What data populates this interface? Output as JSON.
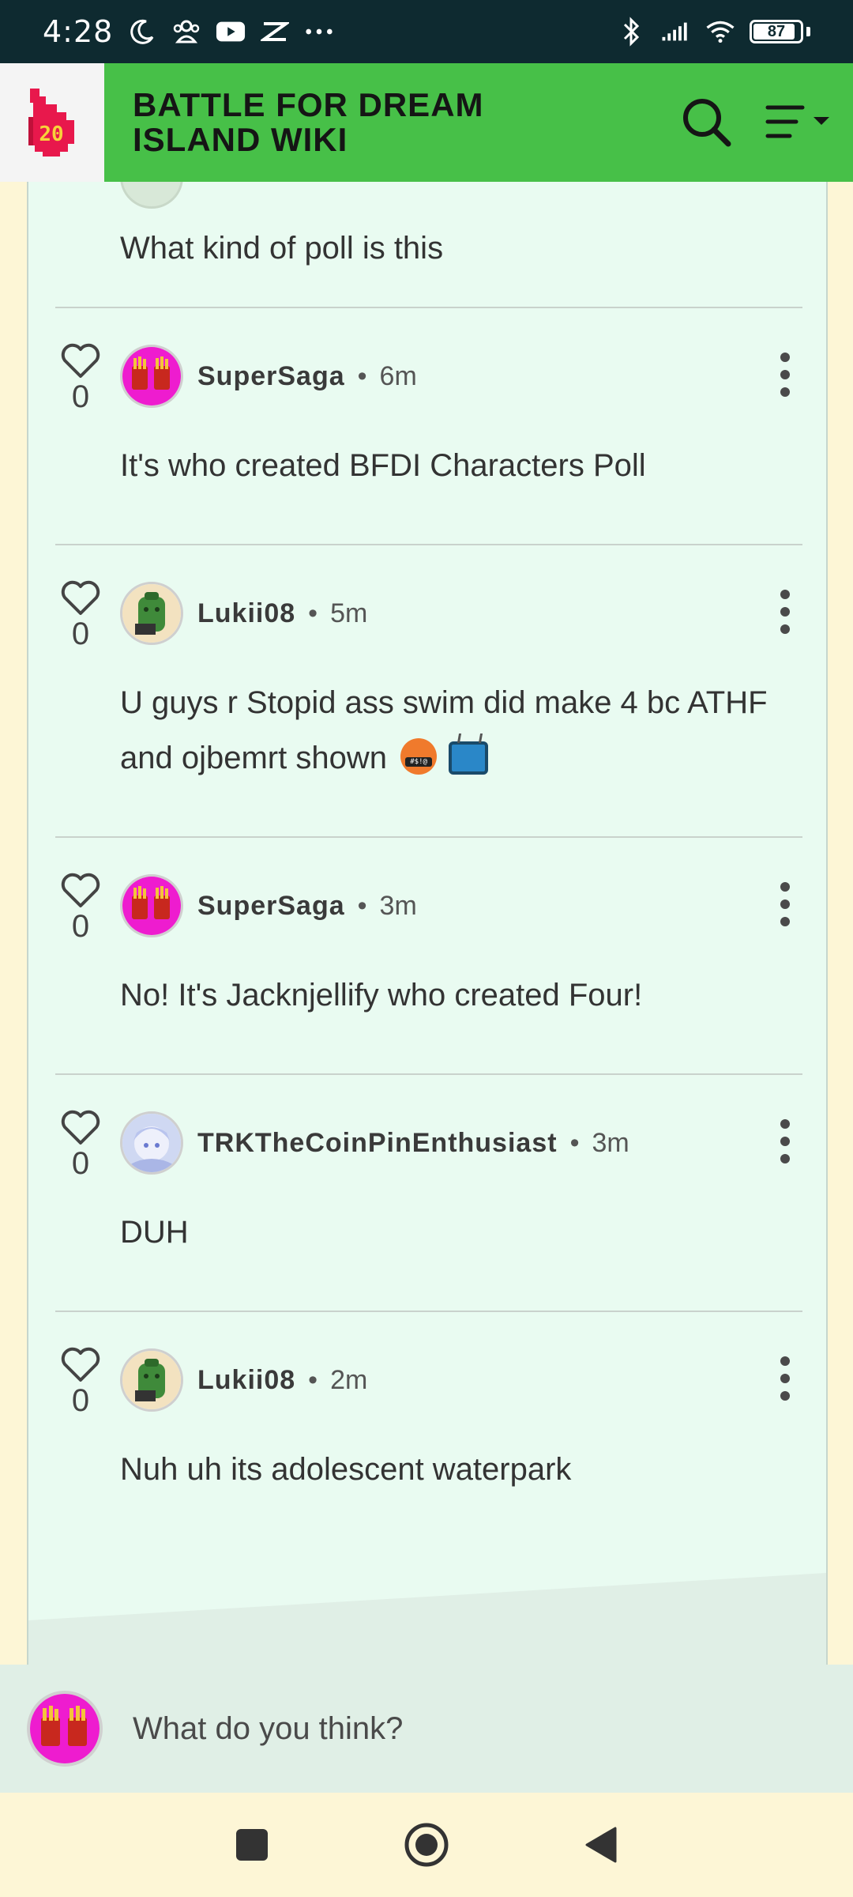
{
  "status_bar": {
    "time": "4:28",
    "battery": "87"
  },
  "header": {
    "logo_text": "20",
    "title": "BATTLE FOR DREAM ISLAND WIKI"
  },
  "first_comment_text": "What kind of poll is this",
  "comments": [
    {
      "username": "SuperSaga",
      "ago": "6m",
      "likes": "0",
      "text": "It's who created BFDI Characters Poll",
      "avatar": "fries"
    },
    {
      "username": "Lukii08",
      "ago": "5m",
      "likes": "0",
      "text": "U guys r Stopid  ass swim did make 4 bc ATHF and ojbemrt shown",
      "avatar": "green-bag"
    },
    {
      "username": "SuperSaga",
      "ago": "3m",
      "likes": "0",
      "text": "No! It's Jacknjellify who created Four!",
      "avatar": "fries"
    },
    {
      "username": "TRKTheCoinPinEnthusiast",
      "ago": "3m",
      "likes": "0",
      "text": "DUH",
      "avatar": "anime-girl"
    },
    {
      "username": "Lukii08",
      "ago": "2m",
      "likes": "0",
      "text": "Nuh uh its adolescent waterpark",
      "avatar": "green-bag"
    }
  ],
  "separator": "•",
  "reply_bar": {
    "placeholder": "What do you think?"
  },
  "colors": {
    "header_green": "#47c048",
    "card_bg": "#e9fbf1",
    "page_bg": "#fdf6d6",
    "logo_red": "#e8184c"
  }
}
